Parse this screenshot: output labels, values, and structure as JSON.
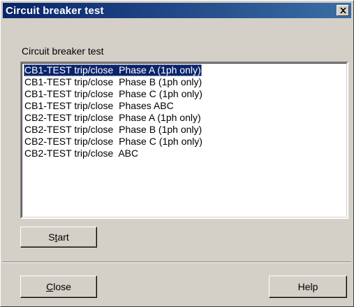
{
  "window": {
    "title": "Circuit breaker test"
  },
  "group": {
    "label": "Circuit breaker test"
  },
  "list": {
    "items": [
      "CB1-TEST trip/close  Phase A (1ph only)",
      "CB1-TEST trip/close  Phase B (1ph only)",
      "CB1-TEST trip/close  Phase C (1ph only)",
      "CB1-TEST trip/close  Phases ABC",
      "CB2-TEST trip/close  Phase A (1ph only)",
      "CB2-TEST trip/close  Phase B (1ph only)",
      "CB2-TEST trip/close  Phase C (1ph only)",
      "CB2-TEST trip/close  ABC"
    ],
    "selected_index": 0
  },
  "buttons": {
    "start_pre": "S",
    "start_mnemonic": "t",
    "start_post": "art",
    "close_pre": "",
    "close_mnemonic": "C",
    "close_post": "lose",
    "help": "Help"
  },
  "icons": {
    "title_close": "close-icon"
  },
  "colors": {
    "title_gradient_start": "#0a246a",
    "title_gradient_end": "#3a6ea5",
    "selection": "#0a246a",
    "face": "#d4d0c8"
  }
}
